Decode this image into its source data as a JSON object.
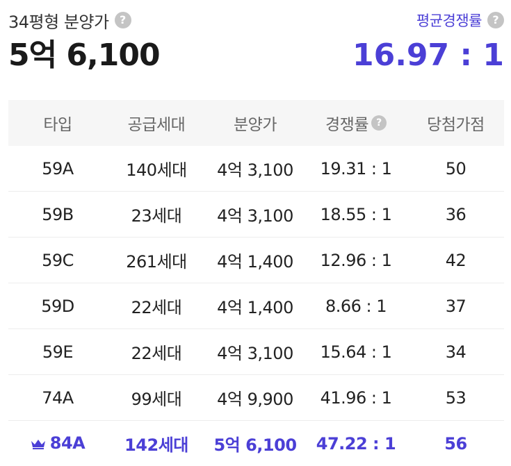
{
  "summary": {
    "price_label": "34평형 분양가",
    "price_value": "5억 6,100",
    "rate_label": "평균경쟁률",
    "rate_value": "16.97 : 1",
    "help_glyph": "?"
  },
  "table": {
    "headers": [
      "타입",
      "공급세대",
      "분양가",
      "경쟁률",
      "당첨가점"
    ],
    "rows": [
      [
        "59A",
        "140세대",
        "4억 3,100",
        "19.31 : 1",
        "50"
      ],
      [
        "59B",
        "23세대",
        "4억 3,100",
        "18.55 : 1",
        "36"
      ],
      [
        "59C",
        "261세대",
        "4억 1,400",
        "12.96 : 1",
        "42"
      ],
      [
        "59D",
        "22세대",
        "4억 1,400",
        "8.66 : 1",
        "37"
      ],
      [
        "59E",
        "22세대",
        "4억 3,100",
        "15.64 : 1",
        "34"
      ],
      [
        "74A",
        "99세대",
        "4억 9,900",
        "41.96 : 1",
        "53"
      ],
      [
        "84A",
        "142세대",
        "5억 6,100",
        "47.22 : 1",
        "56"
      ]
    ]
  },
  "colors": {
    "accent": "#4b3fd6",
    "help_icon_bg": "#c4c4c4",
    "header_bg": "#f6f6f6"
  },
  "icons": {
    "help": "help-circle-icon",
    "highlight_row": "crown-icon"
  }
}
